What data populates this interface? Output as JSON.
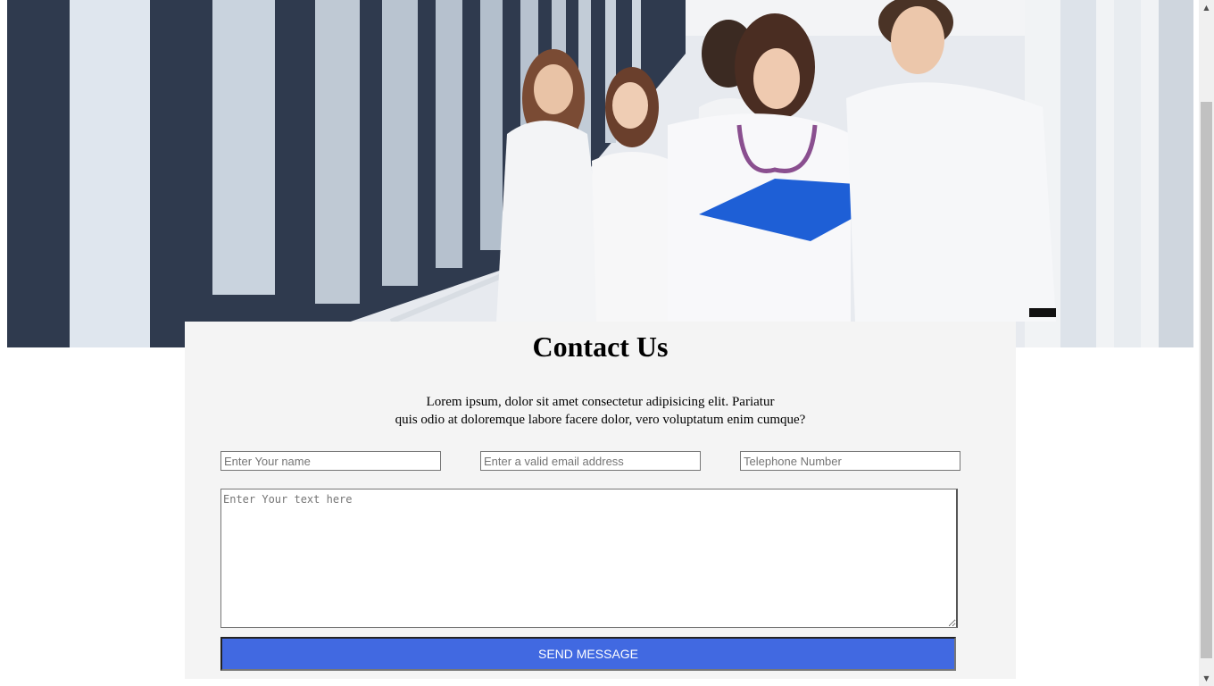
{
  "hero": {
    "image_description": "Medical professionals in white coats walking in a hospital corridor"
  },
  "contact": {
    "title": "Contact Us",
    "description_line1": "Lorem ipsum, dolor sit amet consectetur adipisicing elit. Pariatur",
    "description_line2": "quis odio at doloremque labore facere dolor, vero voluptatum enim cumque?",
    "name_placeholder": "Enter Your name",
    "email_placeholder": "Enter a valid email address",
    "phone_placeholder": "Telephone Number",
    "message_placeholder": "Enter Your text here",
    "send_label": "SEND MESSAGE"
  },
  "colors": {
    "button": "#4169e1",
    "card_background": "#f4f4f4"
  },
  "scrollbar": {
    "up_icon": "arrow-up-icon",
    "down_icon": "arrow-down-icon"
  }
}
